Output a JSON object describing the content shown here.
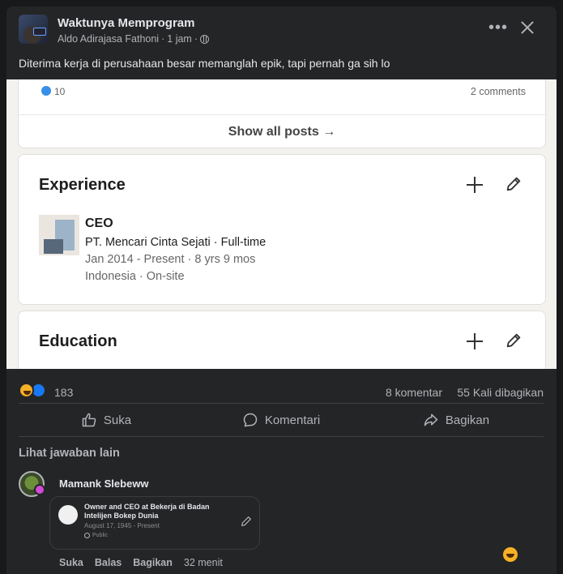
{
  "post": {
    "page_name": "Waktunya Memprogram",
    "author": "Aldo Adirajasa Fathoni",
    "time": "1 jam",
    "caption": "Diterima kerja di perusahaan besar memanglah epik, tapi pernah ga sih lo"
  },
  "image": {
    "likes": "10",
    "comments": "2 comments",
    "show_all": "Show all posts →",
    "experience_title": "Experience",
    "job_title": "CEO",
    "job_company": "PT. Mencari Cinta Sejati · Full-time",
    "job_dates": "Jan 2014 - Present · 8 yrs 9 mos",
    "job_location": "Indonesia · On-site",
    "education_title": "Education"
  },
  "stats": {
    "reactions": "183",
    "comments": "8 komentar",
    "shares": "55 Kali dibagikan"
  },
  "actions": {
    "like": "Suka",
    "comment": "Komentari",
    "share": "Bagikan"
  },
  "see_more": "Lihat jawaban lain",
  "comment": {
    "name": "Mamank Slebeww",
    "attachment_title": "Owner and CEO at Bekerja di Badan Intelijen Bokep Dunia",
    "attachment_date": "August 17, 1945 - Present",
    "attachment_visibility": "Public",
    "like": "Suka",
    "reply": "Balas",
    "share": "Bagikan",
    "time": "32 menit"
  }
}
